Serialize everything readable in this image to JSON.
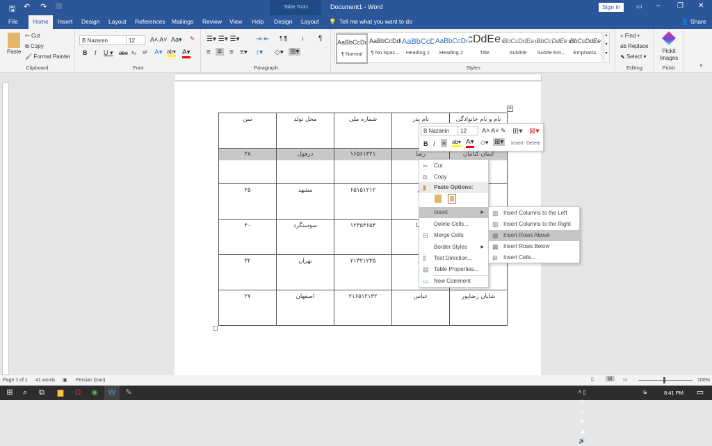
{
  "window": {
    "title": "Document1  -  Word",
    "context_tab": "Table Tools",
    "sign_in": "Sign in",
    "share": "Share"
  },
  "tabs": [
    "File",
    "Home",
    "Insert",
    "Design",
    "Layout",
    "References",
    "Mailings",
    "Review",
    "View",
    "Help",
    "Design",
    "Layout"
  ],
  "tell_me": "Tell me what you want to do",
  "clipboard": {
    "paste": "Paste",
    "cut": "Cut",
    "copy": "Copy",
    "format_painter": "Format Painter",
    "label": "Clipboard"
  },
  "font": {
    "name": "B Nazanin",
    "size": "12",
    "label": "Font"
  },
  "paragraph": {
    "label": "Paragraph"
  },
  "styles": {
    "label": "Styles",
    "items": [
      {
        "preview": "AaBbCcDdEe",
        "name": "¶ Normal"
      },
      {
        "preview": "AaBbCcDdEe",
        "name": "¶ No Spac..."
      },
      {
        "preview": "AaBbCcDdEe",
        "name": "Heading 1"
      },
      {
        "preview": "AaBbCcDdEe",
        "name": "Heading 2"
      },
      {
        "preview": "AaBbCcDdEe",
        "name": "Title"
      },
      {
        "preview": "AaBbCcDdEe",
        "name": "Subtitle"
      },
      {
        "preview": "AaBbCcDdEe",
        "name": "Subtle Em..."
      },
      {
        "preview": "AaBbCcDdEe",
        "name": "Emphasis"
      }
    ]
  },
  "editing": {
    "find": "Find",
    "replace": "Replace",
    "select": "Select",
    "label": "Editing"
  },
  "pickit": {
    "button": "Pickit Images",
    "label": "Pickit"
  },
  "table": {
    "headers": [
      "نام و نام خانوادگی",
      "نام پدر",
      "شماره ملی",
      "محل تولد",
      "سن"
    ],
    "rows": [
      [
        "ایمان کیانیان",
        "رضا",
        "۱۶۵۶۱۳۲۱",
        "دزفول",
        "۲۸"
      ],
      [
        "",
        "ین",
        "۶۵۱۵۱۲۱۲",
        "مشهد",
        "۲۵"
      ],
      [
        "",
        "رضا",
        "۱۲۳۵۴۶۵۴",
        "سوسنگرد",
        "۴۰"
      ],
      [
        "",
        "مد",
        "۲۱۳۲۱۲۳۵",
        "تهران",
        "۳۲"
      ],
      [
        "شایان رضاپور",
        "عباس",
        "۲۱۶۵۱۲۱۳۲",
        "اصفهان",
        "۲۷"
      ]
    ]
  },
  "mini_toolbar": {
    "font": "B Nazanin",
    "size": "12",
    "insert": "Insert",
    "delete": "Delete"
  },
  "context_menu": {
    "items": [
      "Cut",
      "Copy",
      "Paste Options:",
      "Insert",
      "Delete Cells...",
      "Merge Cells",
      "Border Styles",
      "Text Direction...",
      "Table Properties...",
      "New Comment"
    ]
  },
  "submenu": {
    "items": [
      "Insert Columns to the Left",
      "Insert Columns to the Right",
      "Insert Rows Above",
      "Insert Rows Below",
      "Insert Cells..."
    ],
    "highlighted": "Insert Rows Above"
  },
  "status": {
    "page": "Page 1 of 1",
    "words": "41 words",
    "language": "Persian (Iran)",
    "zoom": "100%"
  },
  "taskbar": {
    "time": "8:41 PM",
    "lang": "فا"
  },
  "colors": {
    "brand": "#2b579a",
    "highlight": "#c6c6c6"
  }
}
